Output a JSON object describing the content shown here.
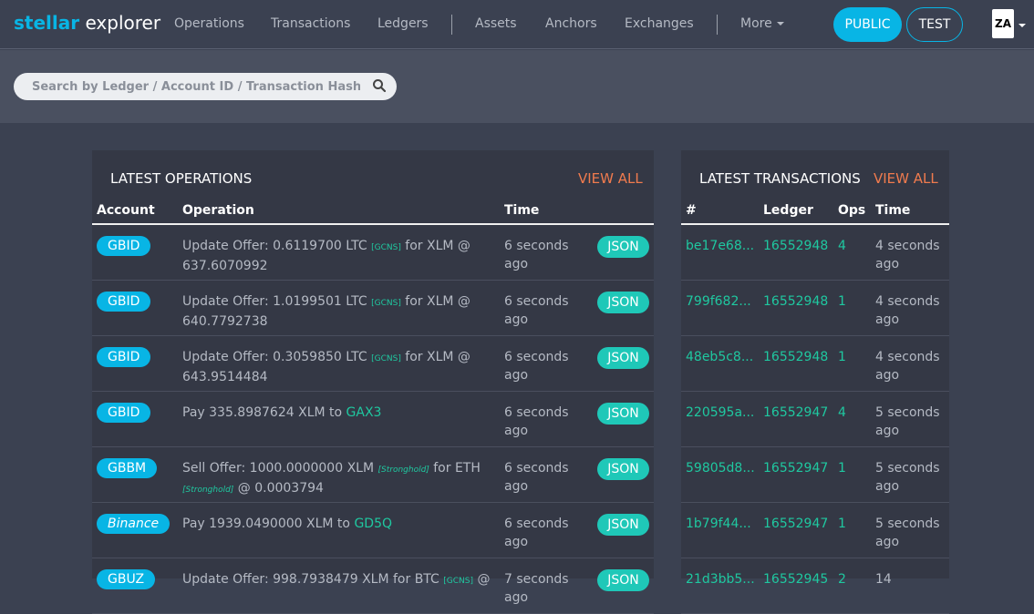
{
  "brand": {
    "part1": "stellar",
    "part2": "explorer"
  },
  "nav": {
    "operations": "Operations",
    "transactions": "Transactions",
    "ledgers": "Ledgers",
    "assets": "Assets",
    "anchors": "Anchors",
    "exchanges": "Exchanges",
    "more": "More"
  },
  "network": {
    "public": "PUBLIC",
    "test": "TEST"
  },
  "language": {
    "flag": "ZA"
  },
  "search": {
    "placeholder": "Search by Ledger / Account ID / Transaction Hash"
  },
  "operations_panel": {
    "title": "LATEST OPERATIONS",
    "view_all": "VIEW ALL",
    "columns": {
      "account": "Account",
      "operation": "Operation",
      "time": "Time"
    },
    "json_label": "JSON",
    "rows": [
      {
        "account": "GBID",
        "parts": [
          [
            "t",
            "Update Offer: 0.6119700 LTC "
          ],
          [
            "tag",
            "[GCNS]"
          ],
          [
            "t",
            " for XLM @ 637.6070992"
          ]
        ],
        "time": "6 seconds ago"
      },
      {
        "account": "GBID",
        "parts": [
          [
            "t",
            "Update Offer: 1.0199501 LTC "
          ],
          [
            "tag",
            "[GCNS]"
          ],
          [
            "t",
            " for XLM @ 640.7792738"
          ]
        ],
        "time": "6 seconds ago"
      },
      {
        "account": "GBID",
        "parts": [
          [
            "t",
            "Update Offer: 0.3059850 LTC "
          ],
          [
            "tag",
            "[GCNS]"
          ],
          [
            "t",
            " for XLM @ 643.9514484"
          ]
        ],
        "time": "6 seconds ago"
      },
      {
        "account": "GBID",
        "parts": [
          [
            "t",
            "Pay 335.8987624 XLM to "
          ],
          [
            "link",
            "GAX3"
          ]
        ],
        "time": "6 seconds ago"
      },
      {
        "account": "GBBM",
        "parts": [
          [
            "t",
            "Sell Offer: 1000.0000000 XLM "
          ],
          [
            "itag",
            "[Stronghold]"
          ],
          [
            "t",
            " for ETH "
          ],
          [
            "itag",
            "[Stronghold]"
          ],
          [
            "t",
            " @ 0.0003794"
          ]
        ],
        "time": "6 seconds ago"
      },
      {
        "account": "Binance",
        "italic": true,
        "parts": [
          [
            "t",
            "Pay 1939.0490000 XLM to "
          ],
          [
            "link",
            "GD5Q"
          ]
        ],
        "time": "6 seconds ago"
      },
      {
        "account": "GBUZ",
        "parts": [
          [
            "t",
            "Update Offer: 998.7938479 XLM for BTC "
          ],
          [
            "tag",
            "[GCNS]"
          ],
          [
            "t",
            " @"
          ]
        ],
        "time": "7 seconds ago"
      }
    ]
  },
  "transactions_panel": {
    "title": "LATEST TRANSACTIONS",
    "view_all": "VIEW ALL",
    "columns": {
      "hash": "#",
      "ledger": "Ledger",
      "ops": "Ops",
      "time": "Time"
    },
    "rows": [
      {
        "hash": "be17e68...",
        "ledger": "16552948",
        "ops": "4",
        "time": "4 seconds ago"
      },
      {
        "hash": "799f682...",
        "ledger": "16552948",
        "ops": "1",
        "time": "4 seconds ago"
      },
      {
        "hash": "48eb5c8...",
        "ledger": "16552948",
        "ops": "1",
        "time": "4 seconds ago"
      },
      {
        "hash": "220595a...",
        "ledger": "16552947",
        "ops": "4",
        "time": "5 seconds ago"
      },
      {
        "hash": "59805d8...",
        "ledger": "16552947",
        "ops": "1",
        "time": "5 seconds ago"
      },
      {
        "hash": "1b79f44...",
        "ledger": "16552947",
        "ops": "1",
        "time": "5 seconds ago"
      },
      {
        "hash": "21d3bb5...",
        "ledger": "16552945",
        "ops": "2",
        "time": "14"
      }
    ]
  },
  "colors": {
    "accent": "#08b5e5",
    "link": "#1fc8a0",
    "view_all": "#f07b4e",
    "json_button": "#1fc8b8",
    "background": "#3b4151",
    "panel": "#343845"
  }
}
